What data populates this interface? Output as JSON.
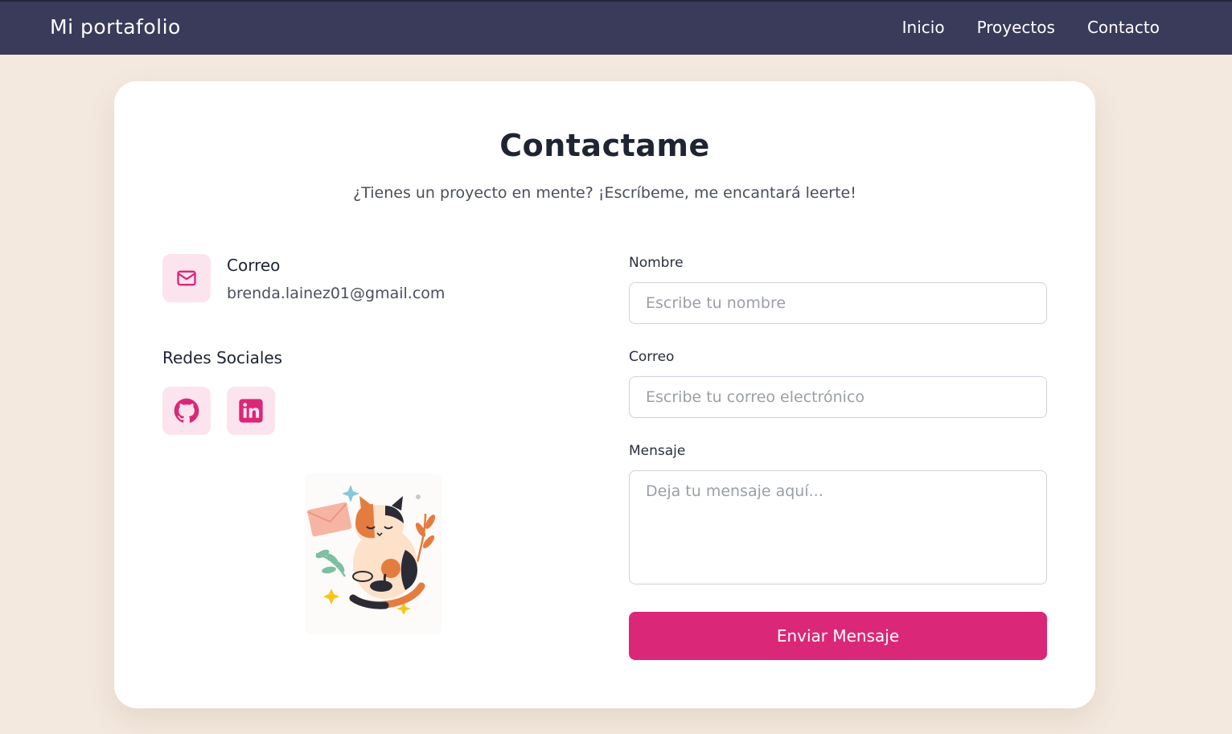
{
  "header": {
    "brand": "Mi portafolio",
    "nav": [
      "Inicio",
      "Proyectos",
      "Contacto"
    ]
  },
  "contact": {
    "title": "Contactame",
    "subtitle": "¿Tienes un proyecto en mente? ¡Escríbeme, me encantará leerte!",
    "email_label": "Correo",
    "email_value": "brenda.lainez01@gmail.com",
    "social_title": "Redes Sociales",
    "socials": [
      "github-icon",
      "linkedin-icon"
    ],
    "illustration": "sleeping-calico-cat-with-envelope"
  },
  "form": {
    "name_label": "Nombre",
    "name_placeholder": "Escribe tu nombre",
    "email_label": "Correo",
    "email_placeholder": "Escribe tu correo electrónico",
    "message_label": "Mensaje",
    "message_placeholder": "Deja tu mensaje aquí...",
    "submit_label": "Enviar Mensaje"
  },
  "colors": {
    "navbar": "#3a3a5a",
    "background": "#f4e9df",
    "accent": "#db2777",
    "icon_bg": "#fce4ef"
  }
}
